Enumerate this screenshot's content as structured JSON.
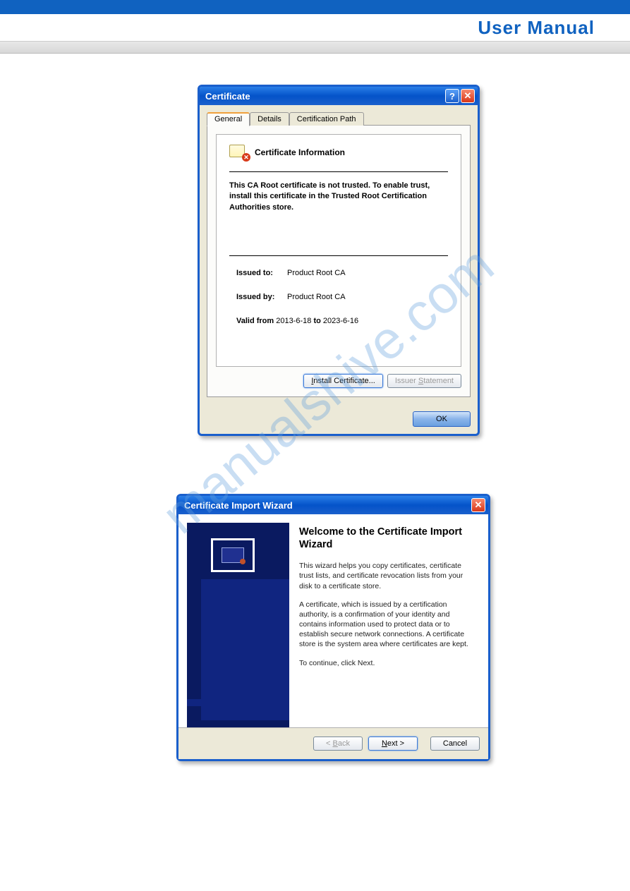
{
  "header": {
    "title": "User Manual"
  },
  "watermark": "manualshive.com",
  "cert_dialog": {
    "title": "Certificate",
    "tabs": {
      "general": "General",
      "details": "Details",
      "certpath": "Certification Path"
    },
    "info_title": "Certificate Information",
    "warning": "This CA Root certificate is not trusted. To enable trust, install this certificate in the Trusted Root Certification Authorities store.",
    "issued_to_label": "Issued to:",
    "issued_to_value": "Product Root CA",
    "issued_by_label": "Issued by:",
    "issued_by_value": "Product Root CA",
    "valid_from_label": "Valid from",
    "valid_from_value": "2013-6-18",
    "valid_to_label": "to",
    "valid_to_value": "2023-6-16",
    "install_btn": "Install Certificate...",
    "issuer_btn": "Issuer Statement",
    "ok_btn": "OK"
  },
  "wizard_dialog": {
    "title": "Certificate Import Wizard",
    "heading": "Welcome to the Certificate Import Wizard",
    "p1": "This wizard helps you copy certificates, certificate trust lists, and certificate revocation lists from your disk to a certificate store.",
    "p2": "A certificate, which is issued by a certification authority, is a confirmation of your identity and contains information used to protect data or to establish secure network connections. A certificate store is the system area where certificates are kept.",
    "p3": "To continue, click Next.",
    "back_btn": "< Back",
    "next_btn": "Next >",
    "cancel_btn": "Cancel"
  }
}
